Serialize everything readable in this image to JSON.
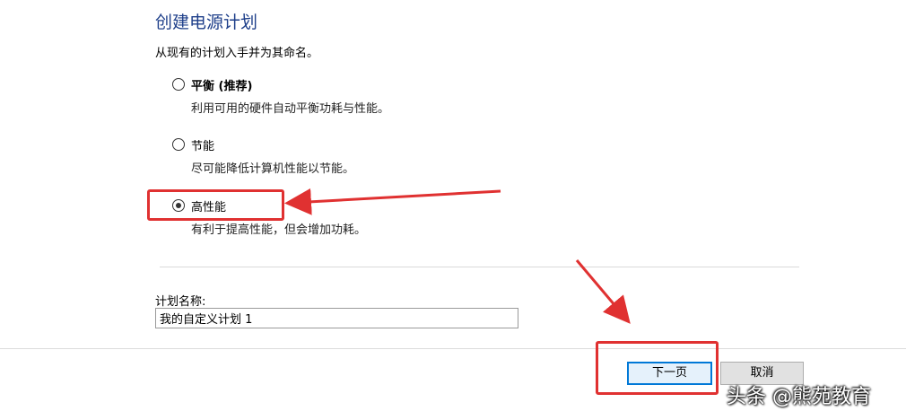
{
  "dialog": {
    "title": "创建电源计划",
    "subtitle": "从现有的计划入手并为其命名。",
    "options": [
      {
        "label": "平衡 (推荐)",
        "description": "利用可用的硬件自动平衡功耗与性能。",
        "checked": false
      },
      {
        "label": "节能",
        "description": "尽可能降低计算机性能以节能。",
        "checked": false
      },
      {
        "label": "高性能",
        "description": "有利于提高性能，但会增加功耗。",
        "checked": true
      }
    ],
    "plan_name_label": "计划名称:",
    "plan_name_value": "我的自定义计划 1"
  },
  "buttons": {
    "next_label": "下一页",
    "cancel_label": "取消"
  },
  "annotation": {
    "color": "#e03131"
  },
  "watermark": {
    "text": "头条 @熊苑教育"
  },
  "colors": {
    "title": "#1e3f8a",
    "button_focus_border": "#0078d7"
  }
}
